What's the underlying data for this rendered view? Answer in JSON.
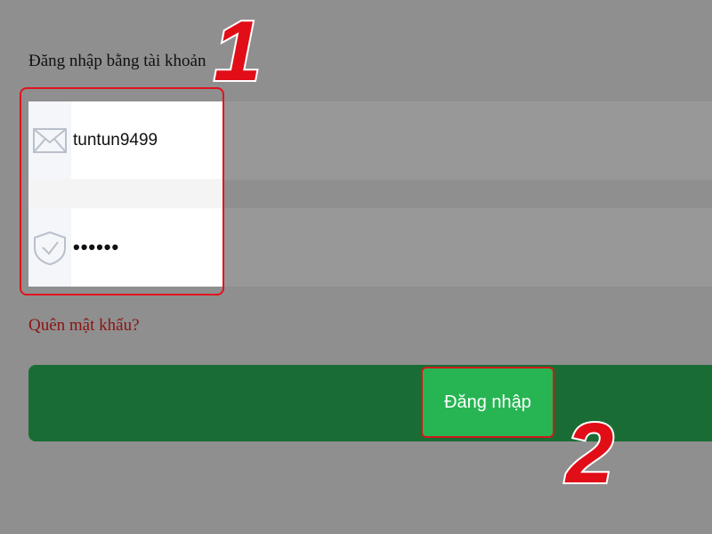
{
  "form": {
    "heading": "Đăng nhập bằng tài khoản",
    "username": {
      "value": "tuntun9499",
      "icon": "envelope-icon"
    },
    "password": {
      "value": "••••••",
      "icon": "shield-check-icon"
    },
    "forgot_link": "Quên mật khẩu?",
    "login_label": "Đăng nhập"
  },
  "annotations": {
    "step1": "1",
    "step2": "2"
  },
  "colors": {
    "background": "#8f8f8f",
    "login_bar": "#196d34",
    "login_button": "#27b553",
    "highlight": "#e0141e",
    "forgot_link": "#8b1414"
  }
}
